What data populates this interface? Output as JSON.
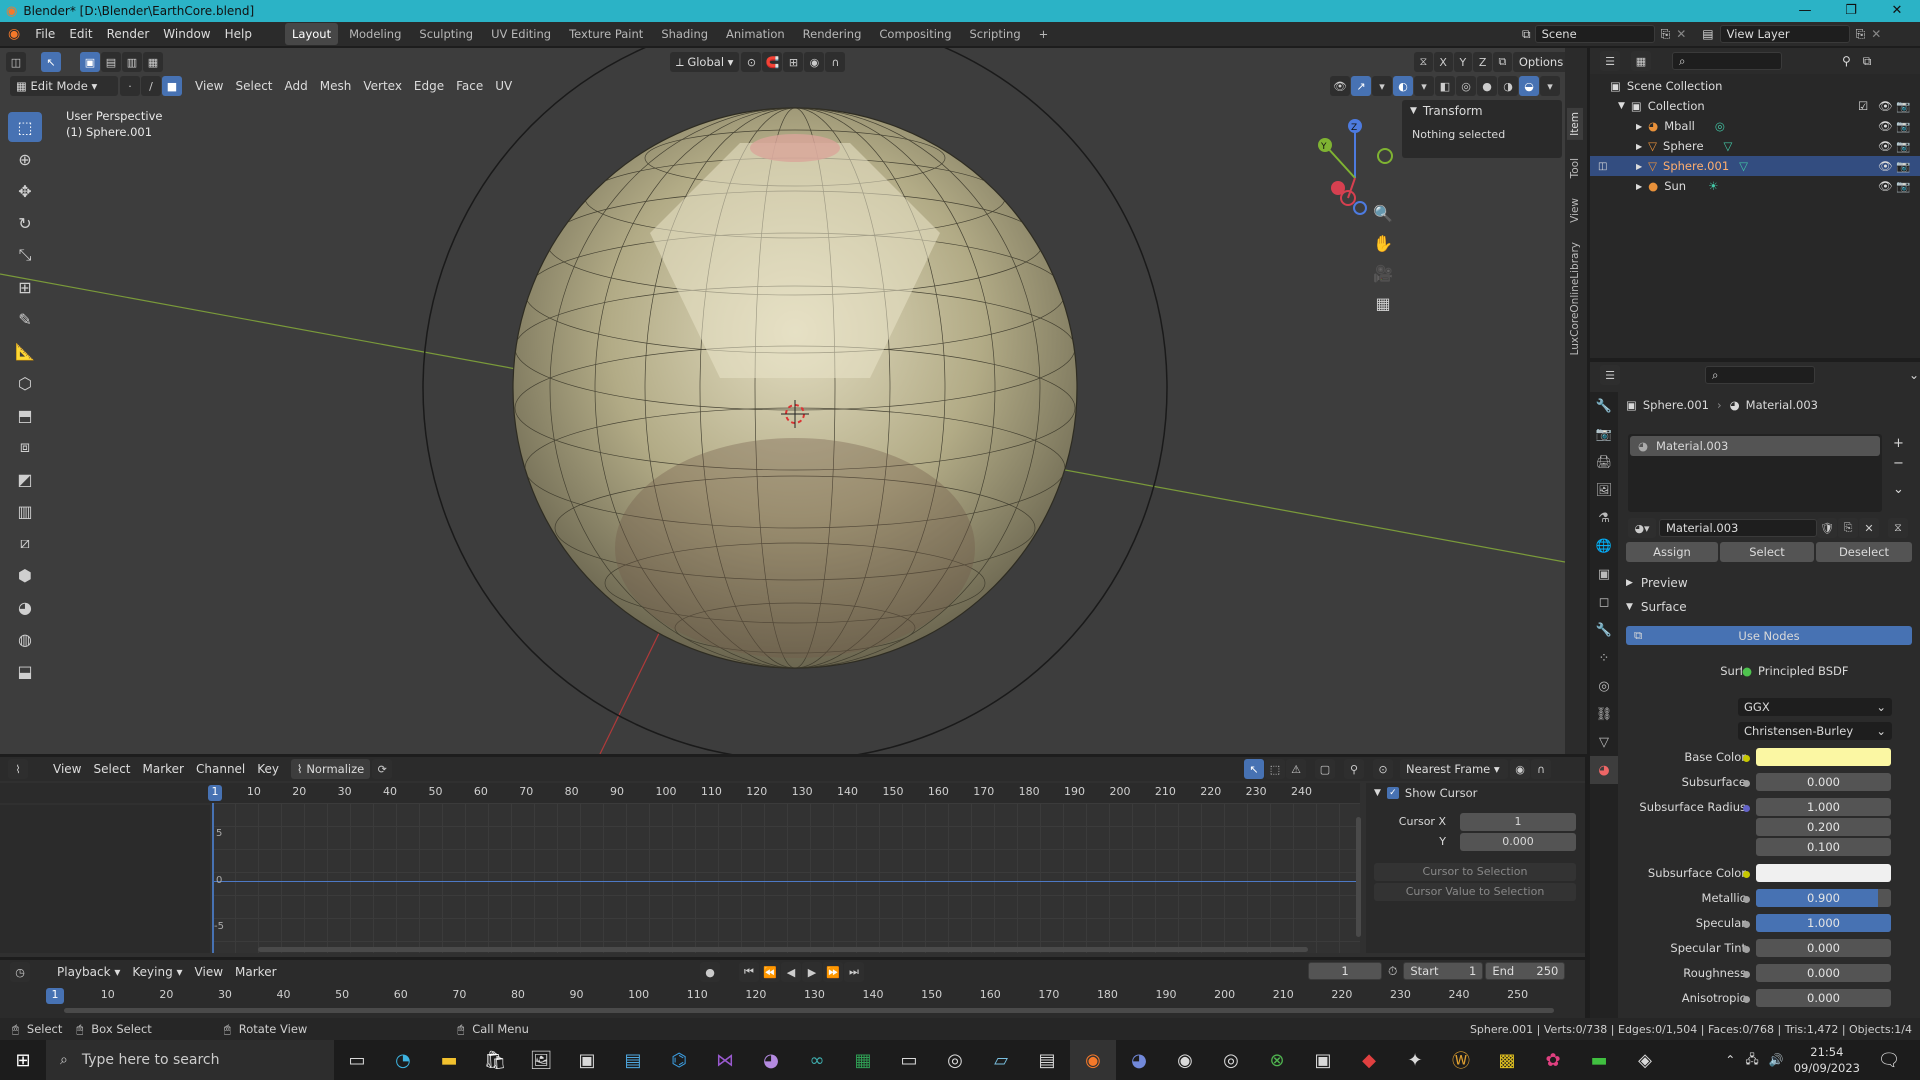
{
  "window": {
    "title": "Blender* [D:\\Blender\\EarthCore.blend]",
    "min": "—",
    "max": "❐",
    "close": "✕"
  },
  "topmenu": {
    "items": [
      "File",
      "Edit",
      "Render",
      "Window",
      "Help"
    ],
    "workspaces": [
      "Layout",
      "Modeling",
      "Sculpting",
      "UV Editing",
      "Texture Paint",
      "Shading",
      "Animation",
      "Rendering",
      "Compositing",
      "Scripting"
    ],
    "add_workspace": "+",
    "scene": "Scene",
    "view_layer": "View Layer"
  },
  "viewport": {
    "mode": "Edit Mode",
    "menus": [
      "View",
      "Select",
      "Add",
      "Mesh",
      "Vertex",
      "Edge",
      "Face",
      "UV"
    ],
    "transform_orientation": "Global",
    "options": "Options",
    "axis_x": "X",
    "axis_y": "Y",
    "axis_z": "Z",
    "overlay_line1": "User Perspective",
    "overlay_line2": "(1) Sphere.001",
    "npanel_title": "Transform",
    "npanel_text": "Nothing selected",
    "side_tabs": [
      "Item",
      "Tool",
      "View",
      "LuxCoreOnlineLibrary"
    ],
    "gizmo": {
      "x": "X",
      "y": "Y",
      "z": "Z"
    }
  },
  "outliner": {
    "root": "Scene Collection",
    "collection": "Collection",
    "items": [
      {
        "name": "Mball"
      },
      {
        "name": "Sphere"
      },
      {
        "name": "Sphere.001"
      },
      {
        "name": "Sun"
      }
    ]
  },
  "properties": {
    "object": "Sphere.001",
    "material": "Material.003",
    "slot": "Material.003",
    "material_field": "Material.003",
    "assign": "Assign",
    "select": "Select",
    "deselect": "Deselect",
    "preview": "Preview",
    "surface_section": "Surface",
    "use_nodes": "Use Nodes",
    "surface_label": "Surface",
    "surface_value": "Principled BSDF",
    "distribution": "GGX",
    "subsurface_method": "Christensen-Burley",
    "rows": [
      {
        "label": "Base Color",
        "value": ""
      },
      {
        "label": "Subsurface",
        "value": "0.000"
      },
      {
        "label": "Subsurface Radius",
        "value": "1.000"
      },
      {
        "label": "",
        "value": "0.200"
      },
      {
        "label": "",
        "value": "0.100"
      },
      {
        "label": "Subsurface Color",
        "value": ""
      },
      {
        "label": "Metallic",
        "value": "0.900"
      },
      {
        "label": "Specular",
        "value": "1.000"
      },
      {
        "label": "Specular Tint",
        "value": "0.000"
      },
      {
        "label": "Roughness",
        "value": "0.000"
      },
      {
        "label": "Anisotropic",
        "value": "0.000"
      }
    ],
    "metallic_level": 0.9,
    "specular_level": 1.0,
    "base_color": "#fbf7a3",
    "subsurface_color": "#f0f0f0"
  },
  "graph": {
    "menus": [
      "View",
      "Select",
      "Marker",
      "Channel",
      "Key"
    ],
    "normalize": "Normalize",
    "snap": "Nearest Frame",
    "ticks": [
      "1",
      "10",
      "20",
      "30",
      "40",
      "50",
      "60",
      "70",
      "80",
      "90",
      "100",
      "110",
      "120",
      "130",
      "140",
      "150",
      "160",
      "170",
      "180",
      "190",
      "200",
      "210",
      "220",
      "230",
      "240"
    ],
    "yticks": [
      "5",
      "0",
      "-5"
    ],
    "show_cursor": "Show Cursor",
    "cursor_x_label": "Cursor X",
    "cursor_x": "1",
    "cursor_y_label": "Y",
    "cursor_y": "0.000",
    "cursor_to_selection": "Cursor to Selection",
    "cursor_value_to_selection": "Cursor Value to Selection"
  },
  "timeline": {
    "menus": [
      "Playback",
      "Keying",
      "View",
      "Marker"
    ],
    "current_frame": "1",
    "start_label": "Start",
    "start": "1",
    "end_label": "End",
    "end": "250",
    "ticks": [
      "1",
      "10",
      "20",
      "30",
      "40",
      "50",
      "60",
      "70",
      "80",
      "90",
      "100",
      "110",
      "120",
      "130",
      "140",
      "150",
      "160",
      "170",
      "180",
      "190",
      "200",
      "210",
      "220",
      "230",
      "240",
      "250"
    ]
  },
  "status": {
    "select": "Select",
    "box_select": "Box Select",
    "rotate_view": "Rotate View",
    "call_menu": "Call Menu",
    "stats": "Sphere.001 | Verts:0/738 | Edges:0/1,504 | Faces:0/768 | Tris:1,472 | Objects:1/4"
  },
  "taskbar": {
    "search_placeholder": "Type here to search",
    "time": "21:54",
    "date": "09/09/2023"
  }
}
